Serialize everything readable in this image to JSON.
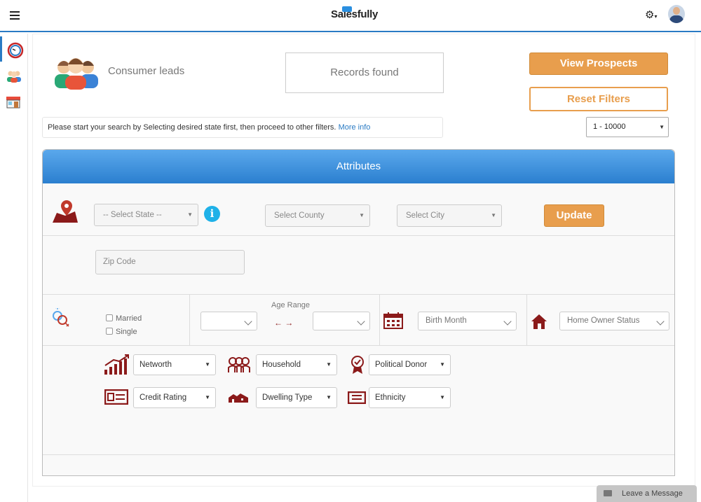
{
  "header": {
    "logo": "Salesfully",
    "menu_icon": "hamburger-icon",
    "settings_icon": "gear-icon"
  },
  "sidebar": {
    "items": [
      {
        "name": "dashboard",
        "icon": "dashboard-gauge-icon"
      },
      {
        "name": "consumer-leads",
        "icon": "people-icon"
      },
      {
        "name": "business-leads",
        "icon": "store-icon"
      }
    ]
  },
  "page": {
    "title": "Consumer leads",
    "records_label": "Records found",
    "view_prospects": "View Prospects",
    "reset_filters": "Reset Filters",
    "info_message": "Please start your search by Selecting desired state first, then proceed to other filters.",
    "more_info": "More info",
    "range_value": "1 - 10000"
  },
  "attributes": {
    "title": "Attributes",
    "state_placeholder": "-- Select State --",
    "county_placeholder": "Select County",
    "city_placeholder": "Select City",
    "update_label": "Update",
    "zip_placeholder": "Zip Code",
    "married_label": "Married",
    "single_label": "Single",
    "age_range_label": "Age Range",
    "age_arrows": "← →",
    "birth_month_placeholder": "Birth Month",
    "home_owner_placeholder": "Home Owner Status",
    "networth_label": "Networth",
    "household_label": "Household",
    "political_donor_label": "Political Donor",
    "credit_rating_label": "Credit Rating",
    "dwelling_type_label": "Dwelling Type",
    "ethnicity_label": "Ethnicity"
  },
  "chat": {
    "label": "Leave a Message"
  },
  "colors": {
    "accent": "#2a7bc4",
    "orange": "#e89e4d",
    "icon_red": "#8b1a1a",
    "info_cyan": "#1fb1e8"
  }
}
